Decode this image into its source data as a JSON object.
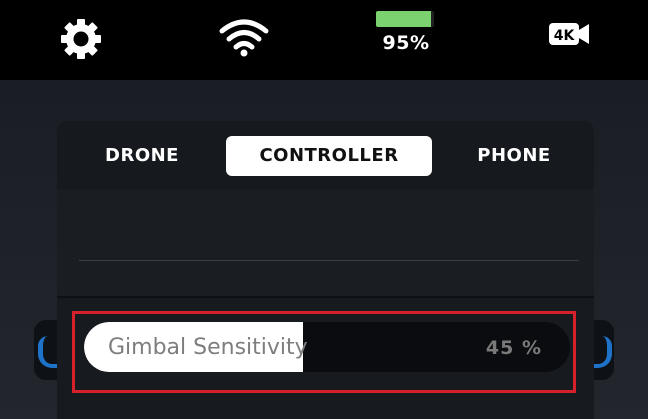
{
  "status_bar": {
    "settings_icon": "gear-icon",
    "wifi_icon": "wifi-icon",
    "battery_percent": 95,
    "battery_text": "95%",
    "battery_color": "#7bd06f",
    "camera_icon": "4k-video-camera-icon",
    "camera_label": "4K"
  },
  "tabs": [
    {
      "label": "DRONE",
      "selected": false
    },
    {
      "label": "CONTROLLER",
      "selected": true
    },
    {
      "label": "PHONE",
      "selected": false
    }
  ],
  "settings": {
    "gimbal_sensitivity": {
      "label": "Gimbal Sensitivity",
      "value": 45,
      "value_text": "45 %"
    }
  },
  "colors": {
    "accent_blue": "#1e73c8",
    "highlight_red": "#d6202a"
  }
}
